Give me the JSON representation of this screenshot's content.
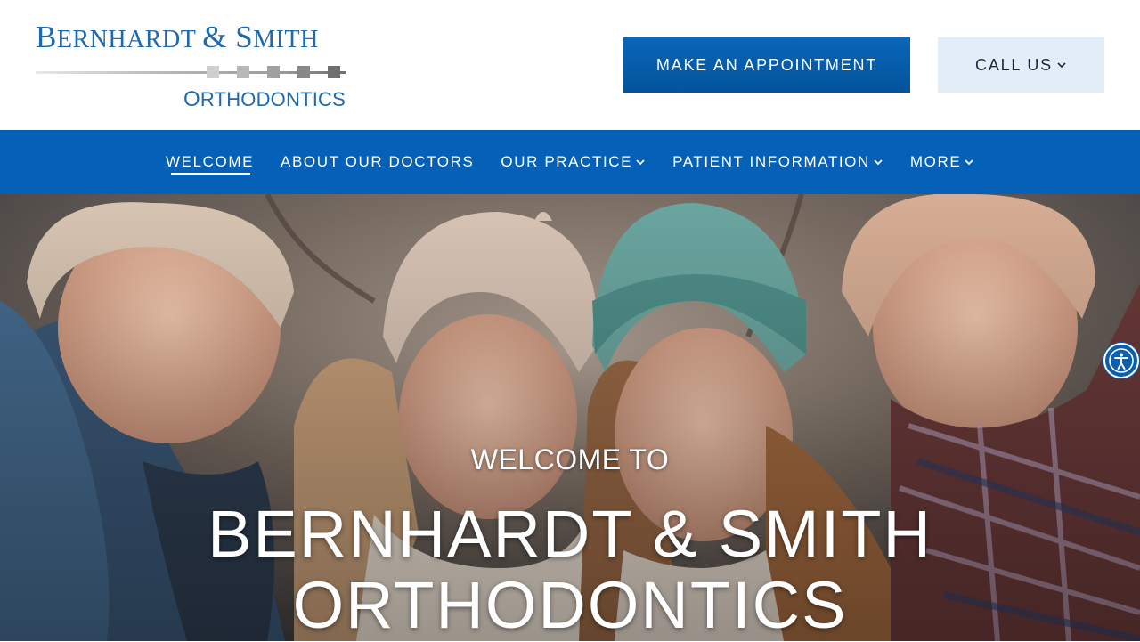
{
  "logo": {
    "line1_b": "B",
    "line1_rest1": "ERNHARDT ",
    "line1_amp": "&",
    "line1_s": " S",
    "line1_rest2": "MITH",
    "line2_o": "O",
    "line2_rest": "RTHODONTICS",
    "square_colors": [
      "#cfcfcf",
      "#b8b8b8",
      "#a0a0a0",
      "#888888",
      "#6f6f6f"
    ]
  },
  "header": {
    "appointment_label": "MAKE AN APPOINTMENT",
    "call_label": "CALL US"
  },
  "nav": {
    "items": [
      {
        "label": "WELCOME",
        "active": true,
        "dropdown": false
      },
      {
        "label": "ABOUT OUR DOCTORS",
        "active": false,
        "dropdown": false
      },
      {
        "label": "OUR PRACTICE",
        "active": false,
        "dropdown": true
      },
      {
        "label": "PATIENT INFORMATION",
        "active": false,
        "dropdown": true
      },
      {
        "label": "MORE",
        "active": false,
        "dropdown": true
      }
    ]
  },
  "hero": {
    "subtitle": "WELCOME TO",
    "title_line1": "BERNHARDT & SMITH",
    "title_line2": "ORTHODONTICS"
  },
  "accessibility": {
    "icon": "accessibility-icon"
  },
  "colors": {
    "brand_blue": "#0561b8",
    "logo_blue": "#1f69ae",
    "call_bg": "#e3edf7"
  }
}
